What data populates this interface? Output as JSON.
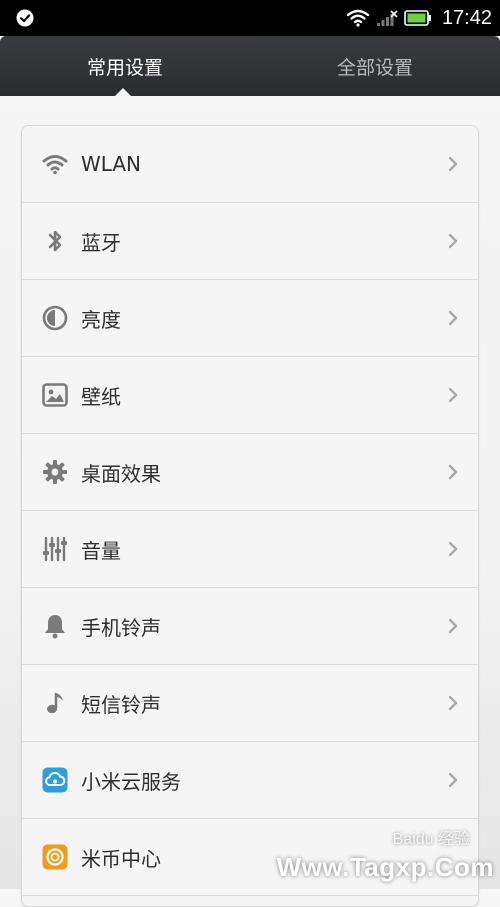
{
  "status_bar": {
    "time": "17:42",
    "icons": [
      "check-circle-icon",
      "wifi-icon",
      "signal-icon",
      "battery-charging-icon"
    ],
    "battery_color": "#6bd33b"
  },
  "tabs": [
    {
      "label": "常用设置",
      "active": true
    },
    {
      "label": "全部设置",
      "active": false
    }
  ],
  "settings": [
    {
      "label": "WLAN",
      "icon": "wifi-icon"
    },
    {
      "label": "蓝牙",
      "icon": "bluetooth-icon"
    },
    {
      "label": "亮度",
      "icon": "brightness-icon"
    },
    {
      "label": "壁纸",
      "icon": "wallpaper-icon"
    },
    {
      "label": "桌面效果",
      "icon": "gear-icon"
    },
    {
      "label": "音量",
      "icon": "sliders-icon"
    },
    {
      "label": "手机铃声",
      "icon": "bell-icon"
    },
    {
      "label": "短信铃声",
      "icon": "music-note-icon"
    },
    {
      "label": "小米云服务",
      "icon": "cloud-icon",
      "icon_color": "#2d9ce0"
    },
    {
      "label": "米币中心",
      "icon": "coin-icon",
      "icon_color": "#f39a1e"
    }
  ],
  "watermark": {
    "brand": "Baidu 经验",
    "site": "Www.Tagxp.Com"
  },
  "colors": {
    "tab_bar": "#2f3034",
    "active_tab_text": "#ffffff",
    "inactive_tab_text": "#b9babd",
    "row_text": "#2e2e2e",
    "icon_gray": "#7a7a7a"
  }
}
